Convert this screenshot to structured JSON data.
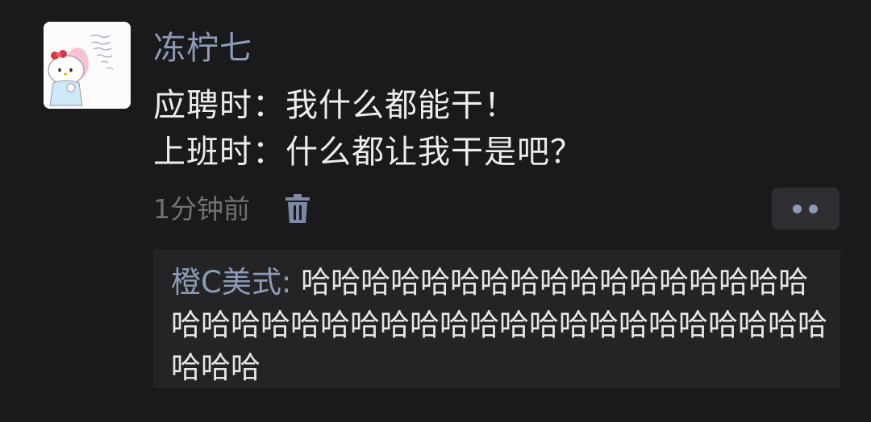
{
  "post": {
    "username": "冻柠七",
    "content_lines": [
      "应聘时：我什么都能干！",
      "上班时：什么都让我干是吧？"
    ],
    "time": "1分钟前"
  },
  "icons": {
    "avatar": "hello-kitty-avatar",
    "delete": "trash-icon",
    "more": "more-dots-icon"
  },
  "reply": {
    "author": "橙C美式",
    "separator": ": ",
    "text": "哈哈哈哈哈哈哈哈哈哈哈哈哈哈哈哈哈哈哈哈哈哈哈哈哈哈哈哈哈哈哈哈哈哈哈哈哈哈哈哈哈哈"
  },
  "colors": {
    "background": "#1a1a1c",
    "username": "#8e9bb6",
    "text": "#ededed",
    "muted": "#717175",
    "reply_background": "#242427"
  }
}
